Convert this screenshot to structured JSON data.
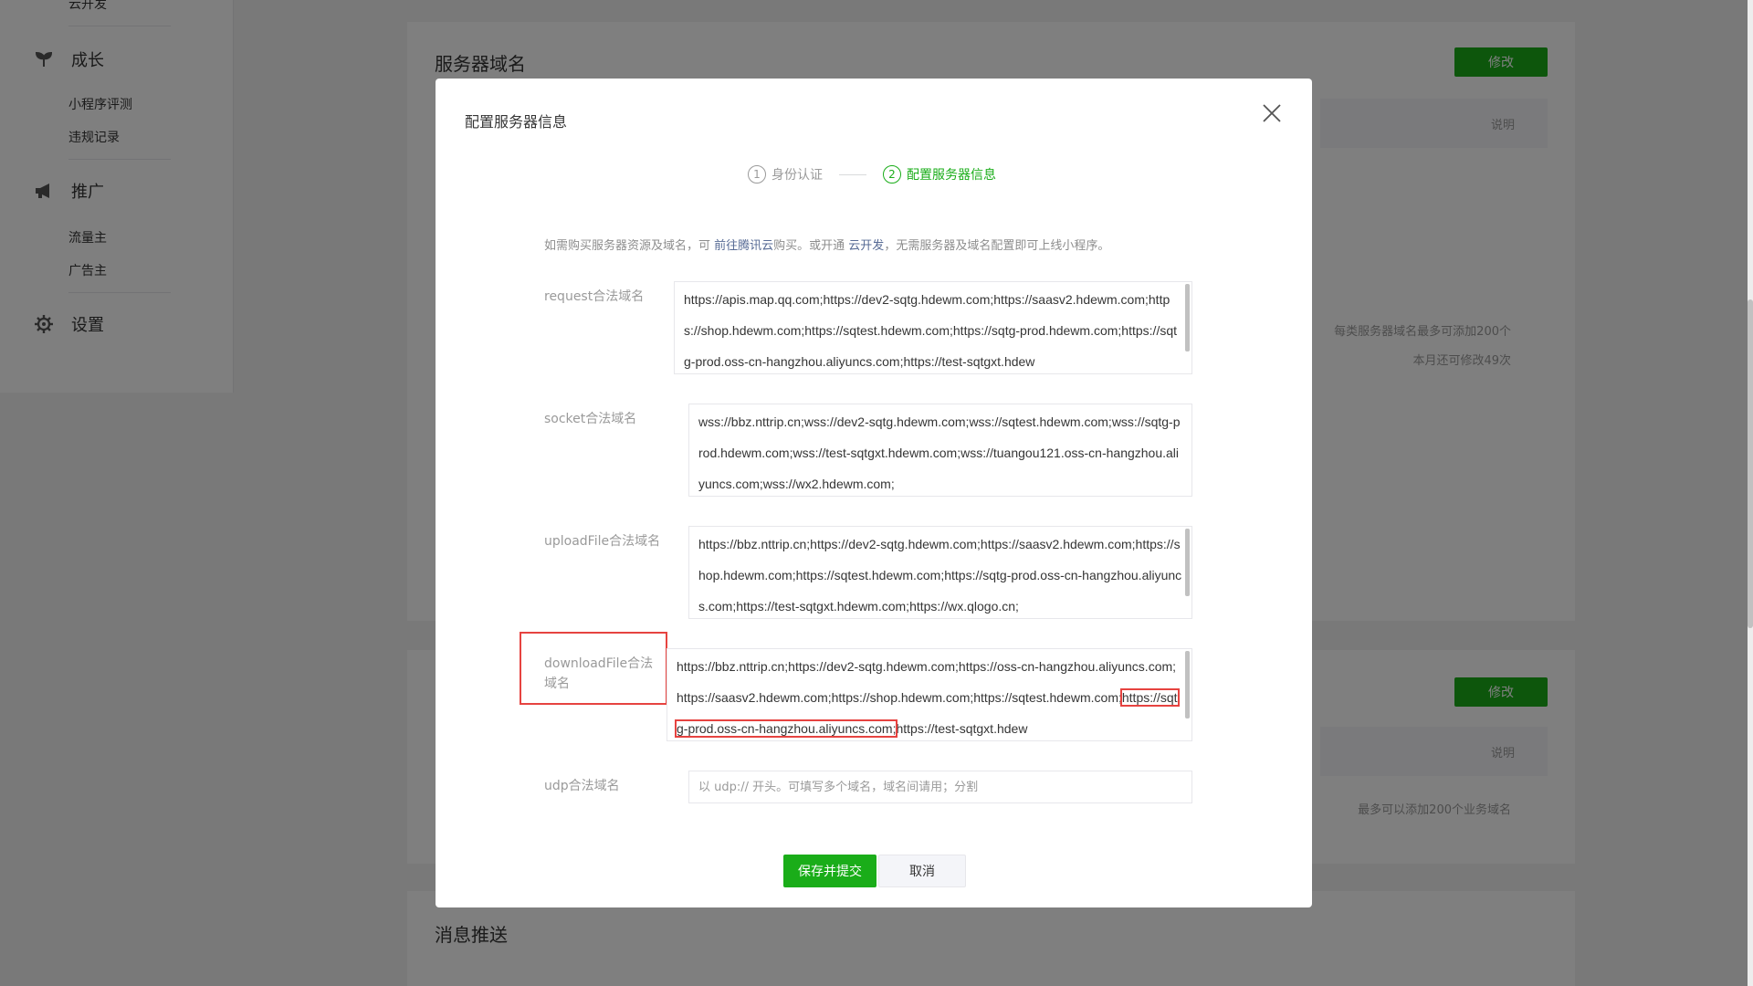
{
  "sidebar": {
    "top_item": "云开发",
    "growth": {
      "label": "成长",
      "items": [
        "小程序评测",
        "违规记录"
      ]
    },
    "promotion": {
      "label": "推广",
      "items": [
        "流量主",
        "广告主"
      ]
    },
    "settings": {
      "label": "设置"
    }
  },
  "page": {
    "server_domain_card": {
      "title": "服务器域名",
      "modify_label": "修改",
      "desc_header": "说明",
      "note_1": "每类服务器域名最多可添加200个",
      "note_2": "本月还可修改49次"
    },
    "business_domain_card": {
      "modify_label": "修改",
      "desc_header": "说明",
      "note": "最多可以添加200个业务域名"
    },
    "message_push_card": {
      "title": "消息推送"
    }
  },
  "modal": {
    "title": "配置服务器信息",
    "steps": [
      {
        "num": "1",
        "label": "身份认证"
      },
      {
        "num": "2",
        "label": "配置服务器信息"
      }
    ],
    "tip": {
      "prefix": "如需购买服务器资源及域名，可 ",
      "link1": "前往腾讯云",
      "middle": "购买。或开通 ",
      "link2": "云开发",
      "suffix": "，无需服务器及域名配置即可上线小程序。"
    },
    "fields": {
      "request": {
        "label": "request合法域名",
        "value": "https://apis.map.qq.com;https://dev2-sqtg.hdewm.com;https://saasv2.hdewm.com;https://shop.hdewm.com;https://sqtest.hdewm.com;https://sqtg-prod.hdewm.com;https://sqtg-prod.oss-cn-hangzhou.aliyuncs.com;https://test-sqtgxt.hdew"
      },
      "socket": {
        "label": "socket合法域名",
        "value": "wss://bbz.nttrip.cn;wss://dev2-sqtg.hdewm.com;wss://sqtest.hdewm.com;wss://sqtg-prod.hdewm.com;wss://test-sqtgxt.hdewm.com;wss://tuangou121.oss-cn-hangzhou.aliyuncs.com;wss://wx2.hdewm.com;"
      },
      "uploadFile": {
        "label": "uploadFile合法域名",
        "value": "https://bbz.nttrip.cn;https://dev2-sqtg.hdewm.com;https://saasv2.hdewm.com;https://shop.hdewm.com;https://sqtest.hdewm.com;https://sqtg-prod.oss-cn-hangzhou.aliyuncs.com;https://test-sqtgxt.hdewm.com;https://wx.qlogo.cn;"
      },
      "downloadFile": {
        "label_line1": "downloadFile合法",
        "label_line2": "域名",
        "value_before": "https://bbz.nttrip.cn;https://dev2-sqtg.hdewm.com;https://oss-cn-hangzhou.aliyuncs.com;https://saasv2.hdewm.com;https://shop.hdewm.com;https://sqtest.hdewm.com;",
        "value_highlight": "https://sqtg-prod.oss-cn-hangzhou.aliyuncs.com;",
        "value_after": "https://test-sqtgxt.hdew"
      },
      "udp": {
        "label": "udp合法域名",
        "placeholder": "以 udp:// 开头。可填写多个域名，域名间请用；分割"
      }
    },
    "save_label": "保存并提交",
    "cancel_label": "取消"
  },
  "colors": {
    "primary_green": "#1aad19",
    "highlight_red": "#e64340",
    "link_blue": "#576b95"
  }
}
